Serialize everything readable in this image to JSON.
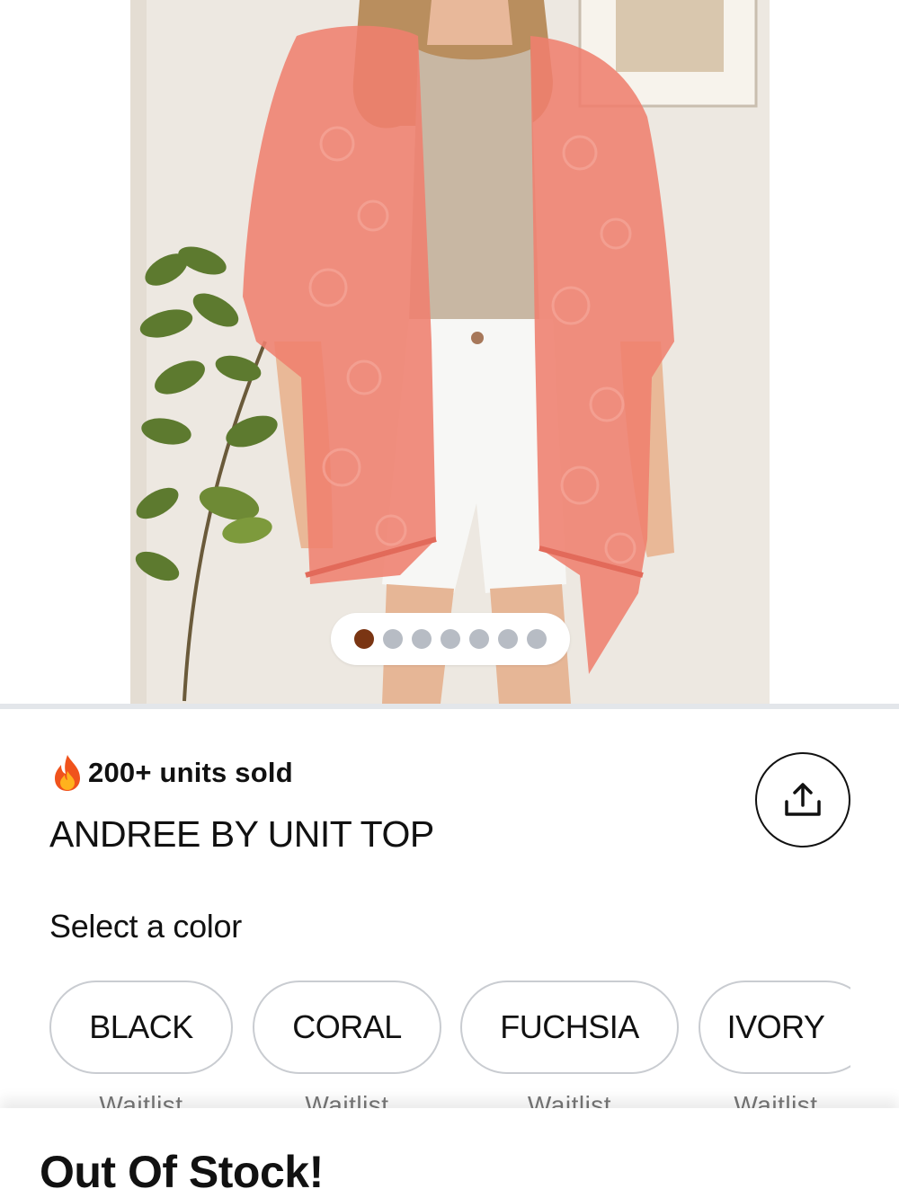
{
  "gallery": {
    "image_count": 7,
    "active_index": 0
  },
  "product": {
    "units_sold": "200+ units sold",
    "title": "ANDREE BY UNIT TOP"
  },
  "colors": {
    "label": "Select a color",
    "options": [
      {
        "name": "BLACK",
        "status": "Waitlist"
      },
      {
        "name": "CORAL",
        "status": "Waitlist"
      },
      {
        "name": "FUCHSIA",
        "status": "Waitlist"
      },
      {
        "name": "IVORY",
        "status": "Waitlist"
      }
    ]
  },
  "footer": {
    "stock_status": "Out Of Stock!"
  },
  "icons": {
    "units_sold": "fire-icon",
    "share": "share-icon"
  },
  "theme": {
    "active_dot": "#7a3513",
    "inactive_dot": "#b7bcc4",
    "chip_border": "#c9ccd1",
    "garment": "#ef7f6e"
  }
}
